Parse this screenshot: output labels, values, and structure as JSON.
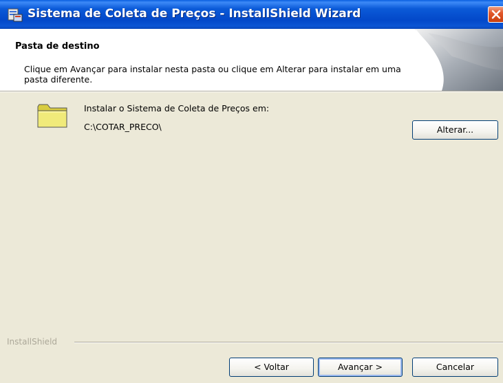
{
  "window": {
    "title": "Sistema de Coleta de Preços - InstallShield Wizard",
    "icon": "installer-icon",
    "close_icon": "close-icon"
  },
  "header": {
    "title": "Pasta de destino",
    "description": "Clique em Avançar para instalar nesta pasta ou clique em Alterar para instalar em uma pasta diferente.",
    "art": "page-curl-graphic"
  },
  "body": {
    "folder_icon": "folder-icon",
    "install_label": "Instalar o Sistema de Coleta de Preços em:",
    "install_path": "C:\\COTAR_PRECO\\",
    "change_button": "Alterar..."
  },
  "footer": {
    "brand": "InstallShield",
    "back_button": "< Voltar",
    "next_button": "Avançar >",
    "cancel_button": "Cancelar"
  },
  "colors": {
    "titlebar": "#0348c9",
    "dialog_background": "#ece9d8",
    "header_background": "#ffffff",
    "close_button": "#e2582c",
    "folder": "#f0ea7a"
  }
}
